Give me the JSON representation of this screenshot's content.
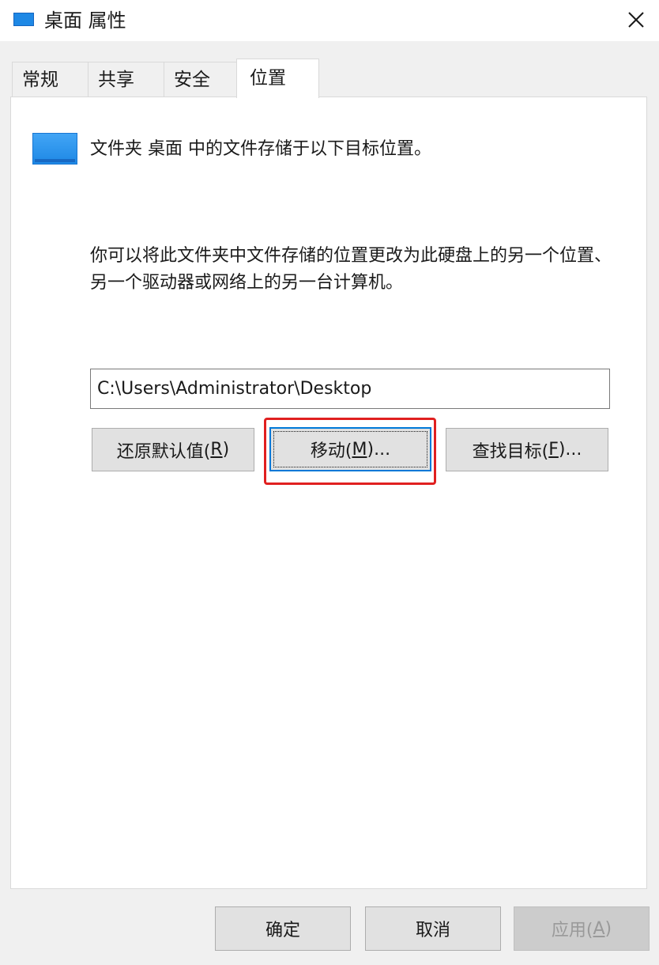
{
  "window": {
    "title": "桌面 属性",
    "icon": "folder-icon",
    "close_icon": "close-icon"
  },
  "tabs": [
    {
      "label": "常规",
      "active": false
    },
    {
      "label": "共享",
      "active": false
    },
    {
      "label": "安全",
      "active": false
    },
    {
      "label": "位置",
      "active": true
    }
  ],
  "location": {
    "heading": "文件夹 桌面 中的文件存储于以下目标位置。",
    "description": "你可以将此文件夹中文件存储的位置更改为此硬盘上的另一个位置、另一个驱动器或网络上的另一台计算机。",
    "path_value": "C:\\Users\\Administrator\\Desktop",
    "buttons": {
      "restore": {
        "text": "还原默认值(",
        "key": "R",
        "suffix": ")"
      },
      "move": {
        "text": "移动(",
        "key": "M",
        "suffix": ")..."
      },
      "find": {
        "text": "查找目标(",
        "key": "F",
        "suffix": ")..."
      }
    }
  },
  "footer": {
    "ok": "确定",
    "cancel": "取消",
    "apply": {
      "text": "应用(",
      "key": "A",
      "suffix": ")"
    }
  },
  "colors": {
    "accent": "#0078d7",
    "highlight": "#e02020",
    "folder": "#1e88e5"
  }
}
